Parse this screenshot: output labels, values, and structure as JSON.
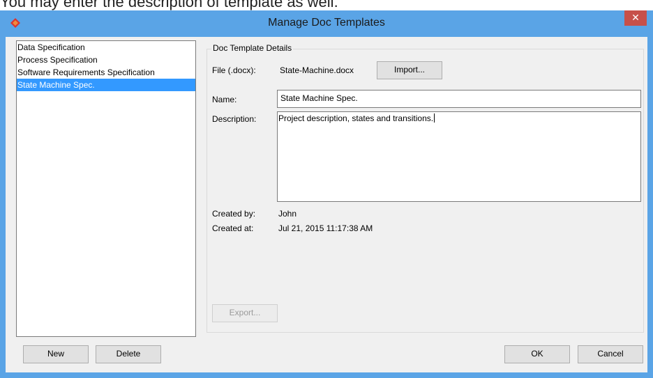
{
  "caption": "You may enter the description of template as well.",
  "window": {
    "title": "Manage Doc Templates",
    "close_glyph": "✕"
  },
  "templates": [
    {
      "label": "Data Specification",
      "selected": false
    },
    {
      "label": "Process Specification",
      "selected": false
    },
    {
      "label": "Software Requirements Specification",
      "selected": false
    },
    {
      "label": "State Machine Spec.",
      "selected": true
    }
  ],
  "details": {
    "group_title": "Doc Template Details",
    "file_label": "File (.docx):",
    "file_value": "State-Machine.docx",
    "import_label": "Import...",
    "name_label": "Name:",
    "name_value": "State Machine Spec.",
    "description_label": "Description:",
    "description_value": "Project description, states and transitions.",
    "created_by_label": "Created by:",
    "created_by_value": "John",
    "created_at_label": "Created at:",
    "created_at_value": "Jul 21, 2015 11:17:38 AM",
    "export_label": "Export..."
  },
  "buttons": {
    "new": "New",
    "delete": "Delete",
    "ok": "OK",
    "cancel": "Cancel"
  },
  "colors": {
    "titlebar": "#5aa4e6",
    "selection": "#3399ff",
    "close": "#c7504a"
  },
  "icons": {
    "app": "app-logo-icon",
    "close": "close-icon"
  }
}
